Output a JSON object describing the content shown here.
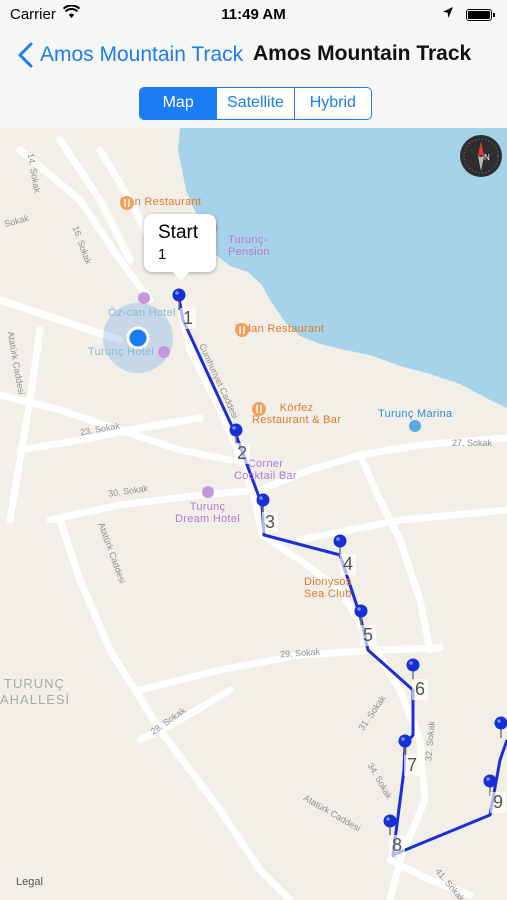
{
  "status": {
    "carrier": "Carrier",
    "time": "11:49 AM"
  },
  "nav": {
    "back_label": "Amos Mountain Track",
    "title": "Amos Mountain Track"
  },
  "segments": [
    "Map",
    "Satellite",
    "Hybrid"
  ],
  "map": {
    "callout": {
      "title": "Start",
      "subtitle": "1"
    },
    "waypoints": [
      "1",
      "2",
      "3",
      "4",
      "5",
      "6",
      "7",
      "8",
      "9"
    ],
    "pois": {
      "han": "Han Restaurant",
      "turunc_pension_1": "Turunç-",
      "turunc_pension_2": "Pension",
      "ozcan": "Öz-can Hotel",
      "turunc_hotel": "Turunç Hotel",
      "fidan": "Fidan Restaurant",
      "korfez_1": "Körfez",
      "korfez_2": "Restaurant & Bar",
      "marina": "Turunç Marina",
      "corner_1": "Corner",
      "corner_2": "Cocktail Bar",
      "dream_1": "Turunç",
      "dream_2": "Dream Hotel",
      "dionysos_1": "Dionysos",
      "dionysos_2": "Sea Club"
    },
    "roads": {
      "sokak14": "14. Sokak",
      "sokak_top": "Sokak",
      "sokak16": "16. Sokak",
      "caddesi_left": "Atatürk Caddesi",
      "cumhuriyet": "Cumhuriyet Caddesi",
      "sokak23": "23. Sokak",
      "sokak27": "27. Sokak",
      "sokak30": "30. Sokak",
      "ataturk_cad": "Atatürk Caddesi",
      "sokak29": "29. Sokak",
      "sokak28": "28. Sokak",
      "sokak31": "31. Sokak",
      "sokak32": "32. Sokak",
      "sokak34": "34. Sokak",
      "ataturk_cad2": "Atatürk Caddesi",
      "sokak41": "41. Sokak"
    },
    "district_1": "TURUNÇ",
    "district_2": "AHALLESİ",
    "legal": "Legal"
  },
  "colors": {
    "accent": "#1a7df5",
    "route": "#1b2fd6",
    "water": "#a6d3ea",
    "land": "#f2efe9",
    "road": "#ffffff"
  },
  "icons": [
    "wifi-icon",
    "location-arrow-icon",
    "battery-icon",
    "chevron-left-icon",
    "compass-icon",
    "map-pin-icon",
    "restaurant-icon",
    "hotel-icon"
  ]
}
